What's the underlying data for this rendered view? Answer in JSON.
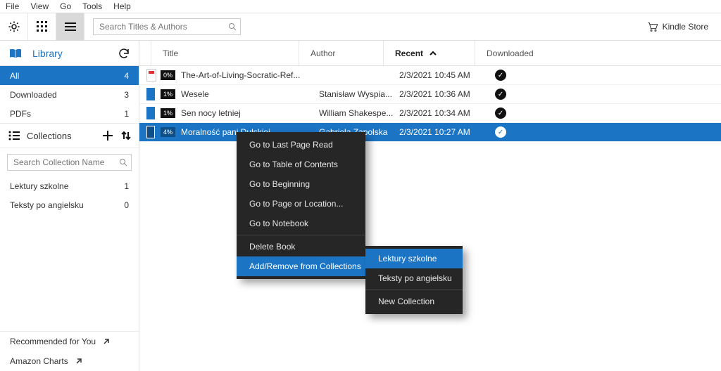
{
  "menubar": {
    "file": "File",
    "view": "View",
    "go": "Go",
    "tools": "Tools",
    "help": "Help"
  },
  "toolbar": {
    "search_placeholder": "Search Titles & Authors",
    "kindle_store": "Kindle Store"
  },
  "library": {
    "label": "Library",
    "filters": {
      "all": {
        "label": "All",
        "count": "4"
      },
      "downloaded": {
        "label": "Downloaded",
        "count": "3"
      },
      "pdfs": {
        "label": "PDFs",
        "count": "1"
      }
    }
  },
  "collections": {
    "header": "Collections",
    "search_placeholder": "Search Collection Name",
    "items": [
      {
        "name": "Lektury szkolne",
        "count": "1"
      },
      {
        "name": "Teksty po angielsku",
        "count": "0"
      }
    ]
  },
  "sidebar_bottom": {
    "recommended": "Recommended for You",
    "amazon_charts": "Amazon Charts"
  },
  "table": {
    "headers": {
      "title": "Title",
      "author": "Author",
      "recent": "Recent",
      "downloaded": "Downloaded"
    },
    "rows": [
      {
        "pct": "0%",
        "title": "The-Art-of-Living-Socratic-Ref...",
        "author": "",
        "recent": "2/3/2021 10:45 AM",
        "downloaded": true,
        "type": "pdf"
      },
      {
        "pct": "1%",
        "title": "Wesele",
        "author": "Stanisław Wyspia...",
        "recent": "2/3/2021 10:36 AM",
        "downloaded": true,
        "type": "book"
      },
      {
        "pct": "1%",
        "title": "Sen nocy letniej",
        "author": "William Shakespe...",
        "recent": "2/3/2021 10:34 AM",
        "downloaded": true,
        "type": "book"
      },
      {
        "pct": "4%",
        "title": "Moralność pani Dulskiej",
        "author": "Gabriela Zapolska",
        "recent": "2/3/2021 10:27 AM",
        "downloaded": true,
        "type": "book"
      }
    ]
  },
  "context_menu": {
    "go_last_page": "Go to Last Page Read",
    "go_toc": "Go to Table of Contents",
    "go_beginning": "Go to Beginning",
    "go_page_loc": "Go to Page or Location...",
    "go_notebook": "Go to Notebook",
    "delete_book": "Delete Book",
    "add_remove_collections": "Add/Remove from Collections",
    "submenu": {
      "lektury": "Lektury szkolne",
      "teksty": "Teksty po angielsku",
      "new_collection": "New Collection"
    }
  }
}
